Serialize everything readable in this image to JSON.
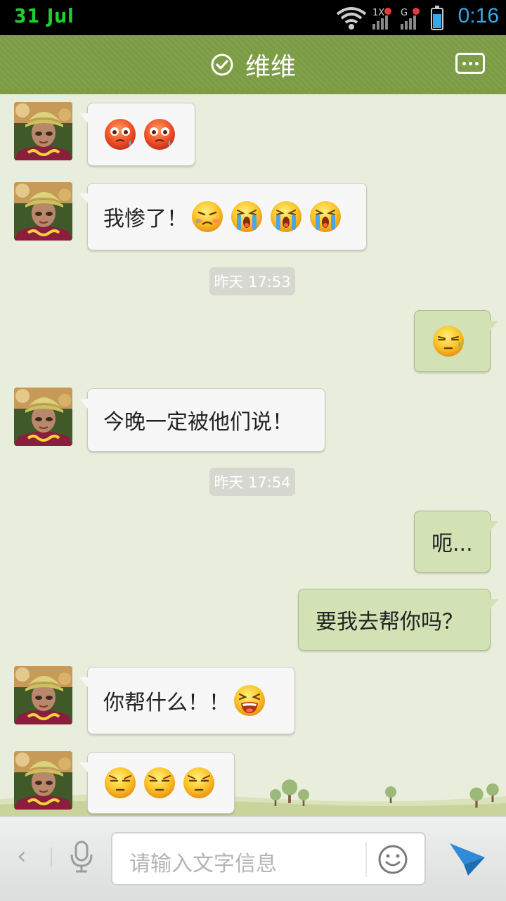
{
  "status_bar": {
    "date": "31 Jul",
    "time": "0:16"
  },
  "header": {
    "title": "维维"
  },
  "messages": [
    {
      "side": "in",
      "text": "",
      "emojis": [
        "red-blushing",
        "red-blushing"
      ]
    },
    {
      "side": "in",
      "text": "我惨了！",
      "emojis": [
        "sad-tear",
        "crying",
        "crying",
        "crying"
      ]
    },
    {
      "type": "time",
      "text": "昨天 17:53"
    },
    {
      "side": "out",
      "text": "",
      "emojis": [
        "sweat-annoyed"
      ]
    },
    {
      "side": "in",
      "text": "今晚一定被他们说！",
      "emojis": []
    },
    {
      "type": "time",
      "text": "昨天 17:54"
    },
    {
      "side": "out",
      "text": "呃...",
      "emojis": []
    },
    {
      "side": "out",
      "text": "要我去帮你吗？",
      "emojis": []
    },
    {
      "side": "in",
      "text": "你帮什么！！",
      "emojis": [
        "laughing-squint"
      ]
    },
    {
      "side": "in",
      "text": "",
      "emojis": [
        "smug",
        "smug",
        "smug"
      ]
    }
  ],
  "input_bar": {
    "placeholder": "请输入文字信息"
  },
  "colors": {
    "header": "#7b9c44",
    "background": "#e8eedb",
    "outgoing_bubble": "#d2e2b4",
    "incoming_bubble": "#f7f7f7"
  }
}
